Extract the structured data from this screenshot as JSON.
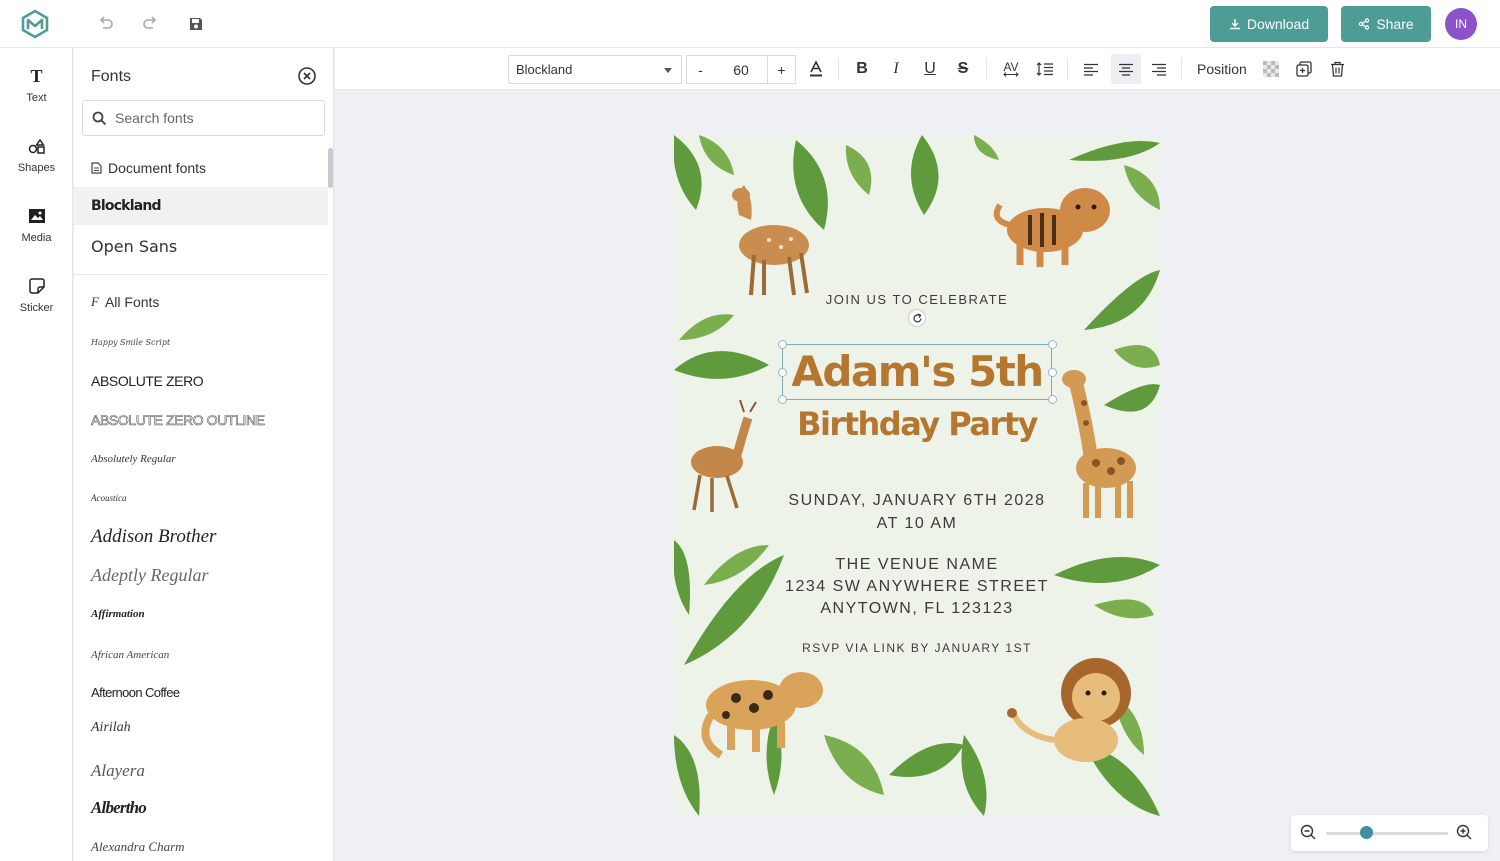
{
  "app": {
    "colors": {
      "accent": "#4d9c95",
      "avatar": "#8b52c9",
      "title_brown": "#b5762f"
    }
  },
  "topbar": {
    "download_label": "Download",
    "share_label": "Share",
    "avatar_initials": "IN",
    "icons": [
      "logo-icon",
      "undo-icon",
      "redo-icon",
      "save-icon",
      "download-icon",
      "share-icon"
    ]
  },
  "rail": {
    "items": [
      {
        "label": "Text",
        "icon": "text-icon"
      },
      {
        "label": "Shapes",
        "icon": "shapes-icon"
      },
      {
        "label": "Media",
        "icon": "media-icon"
      },
      {
        "label": "Sticker",
        "icon": "sticker-icon"
      }
    ]
  },
  "fonts_panel": {
    "title": "Fonts",
    "search_placeholder": "Search fonts",
    "document_fonts_heading": "Document fonts",
    "document_fonts": [
      "Blockland",
      "Open Sans"
    ],
    "selected_font": "Blockland",
    "all_fonts_heading": "All Fonts",
    "all_fonts": [
      "Happy Smile Script",
      "ABSOLUTE ZERO",
      "ABSOLUTE ZERO OUTLINE",
      "Absolutely Regular",
      "Acoustica",
      "Addison Brother",
      "Adeptly Regular",
      "Affirmation",
      "African American",
      "Afternoon Coffee",
      "Airilah",
      "Alayera",
      "Albertho",
      "Alexandra Charm"
    ]
  },
  "format_toolbar": {
    "font_family": "Blockland",
    "minus_label": "-",
    "font_size": "60",
    "plus_label": "+",
    "bold_label": "B",
    "italic_label": "I",
    "underline_label": "U",
    "strike_label": "S",
    "spacing_label": "AV",
    "position_label": "Position",
    "active_alignment": "center"
  },
  "invitation": {
    "line_join": "JOIN US TO CELEBRATE",
    "title_line1": "Adam's 5th",
    "title_line2": "Birthday Party",
    "date_line1": "SUNDAY, JANUARY 6TH 2028",
    "date_line2": "AT 10 AM",
    "venue_line1": "THE VENUE NAME",
    "venue_line2": "1234 SW ANYWHERE STREET",
    "venue_line3": "ANYTOWN, FL 123123",
    "rsvp": "RSVP VIA LINK BY JANUARY 1ST"
  },
  "zoom": {
    "level_fraction": 0.33
  }
}
